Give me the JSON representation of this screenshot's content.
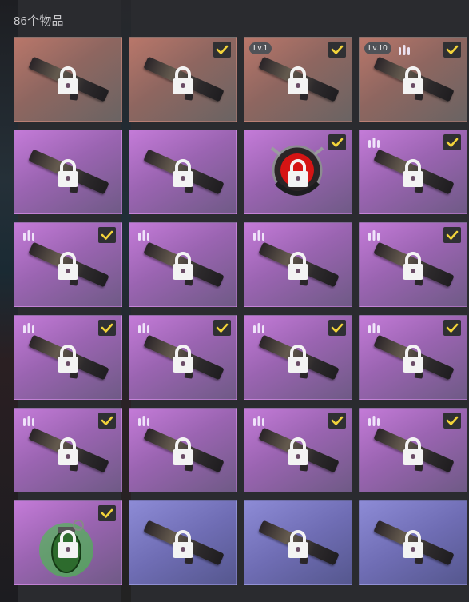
{
  "inventory": {
    "header": "86个物品",
    "items": [
      {
        "bg": "orange",
        "kind": "rifle",
        "checked": false,
        "level": "",
        "rarity_pips": false
      },
      {
        "bg": "orange",
        "kind": "rifle",
        "checked": true,
        "level": "",
        "rarity_pips": false
      },
      {
        "bg": "orange",
        "kind": "rifle",
        "checked": true,
        "level": "Lv.1",
        "rarity_pips": false
      },
      {
        "bg": "orange",
        "kind": "rifle",
        "checked": true,
        "level": "Lv.10",
        "rarity_pips": true
      },
      {
        "bg": "purple",
        "kind": "rifle",
        "checked": false,
        "level": "",
        "rarity_pips": false
      },
      {
        "bg": "purple",
        "kind": "rifle",
        "checked": false,
        "level": "",
        "rarity_pips": false
      },
      {
        "bg": "purple",
        "kind": "emblem",
        "checked": true,
        "level": "",
        "rarity_pips": false
      },
      {
        "bg": "purple",
        "kind": "rifle",
        "checked": true,
        "level": "",
        "rarity_pips": true
      },
      {
        "bg": "purple",
        "kind": "rifle",
        "checked": true,
        "level": "",
        "rarity_pips": true
      },
      {
        "bg": "purple",
        "kind": "rifle",
        "checked": false,
        "level": "",
        "rarity_pips": true
      },
      {
        "bg": "purple",
        "kind": "rifle",
        "checked": false,
        "level": "",
        "rarity_pips": true
      },
      {
        "bg": "purple",
        "kind": "rifle",
        "checked": true,
        "level": "",
        "rarity_pips": true
      },
      {
        "bg": "purple",
        "kind": "rifle",
        "checked": true,
        "level": "",
        "rarity_pips": true
      },
      {
        "bg": "purple",
        "kind": "rifle",
        "checked": true,
        "level": "",
        "rarity_pips": true
      },
      {
        "bg": "purple",
        "kind": "rifle",
        "checked": true,
        "level": "",
        "rarity_pips": true
      },
      {
        "bg": "purple",
        "kind": "rifle",
        "checked": true,
        "level": "",
        "rarity_pips": true
      },
      {
        "bg": "purple",
        "kind": "rifle",
        "checked": true,
        "level": "",
        "rarity_pips": true
      },
      {
        "bg": "purple",
        "kind": "rifle",
        "checked": false,
        "level": "",
        "rarity_pips": true
      },
      {
        "bg": "purple",
        "kind": "rifle",
        "checked": true,
        "level": "",
        "rarity_pips": true
      },
      {
        "bg": "purple",
        "kind": "rifle",
        "checked": true,
        "level": "",
        "rarity_pips": true
      },
      {
        "bg": "purple",
        "kind": "grenade",
        "checked": true,
        "level": "",
        "rarity_pips": false
      },
      {
        "bg": "blue",
        "kind": "rifle",
        "checked": false,
        "level": "",
        "rarity_pips": false
      },
      {
        "bg": "blue",
        "kind": "rifle",
        "checked": false,
        "level": "",
        "rarity_pips": false
      },
      {
        "bg": "blue",
        "kind": "rifle",
        "checked": false,
        "level": "",
        "rarity_pips": false
      }
    ]
  },
  "colors": {
    "check": "#f2d33a",
    "lock": "#f3f3f3",
    "grenade_glow": "#3ccd3c",
    "emblem_red": "#d51414"
  },
  "icons": {
    "lock": "lock-icon",
    "check": "checkmark-icon",
    "pips": "rarity-pips-icon"
  }
}
